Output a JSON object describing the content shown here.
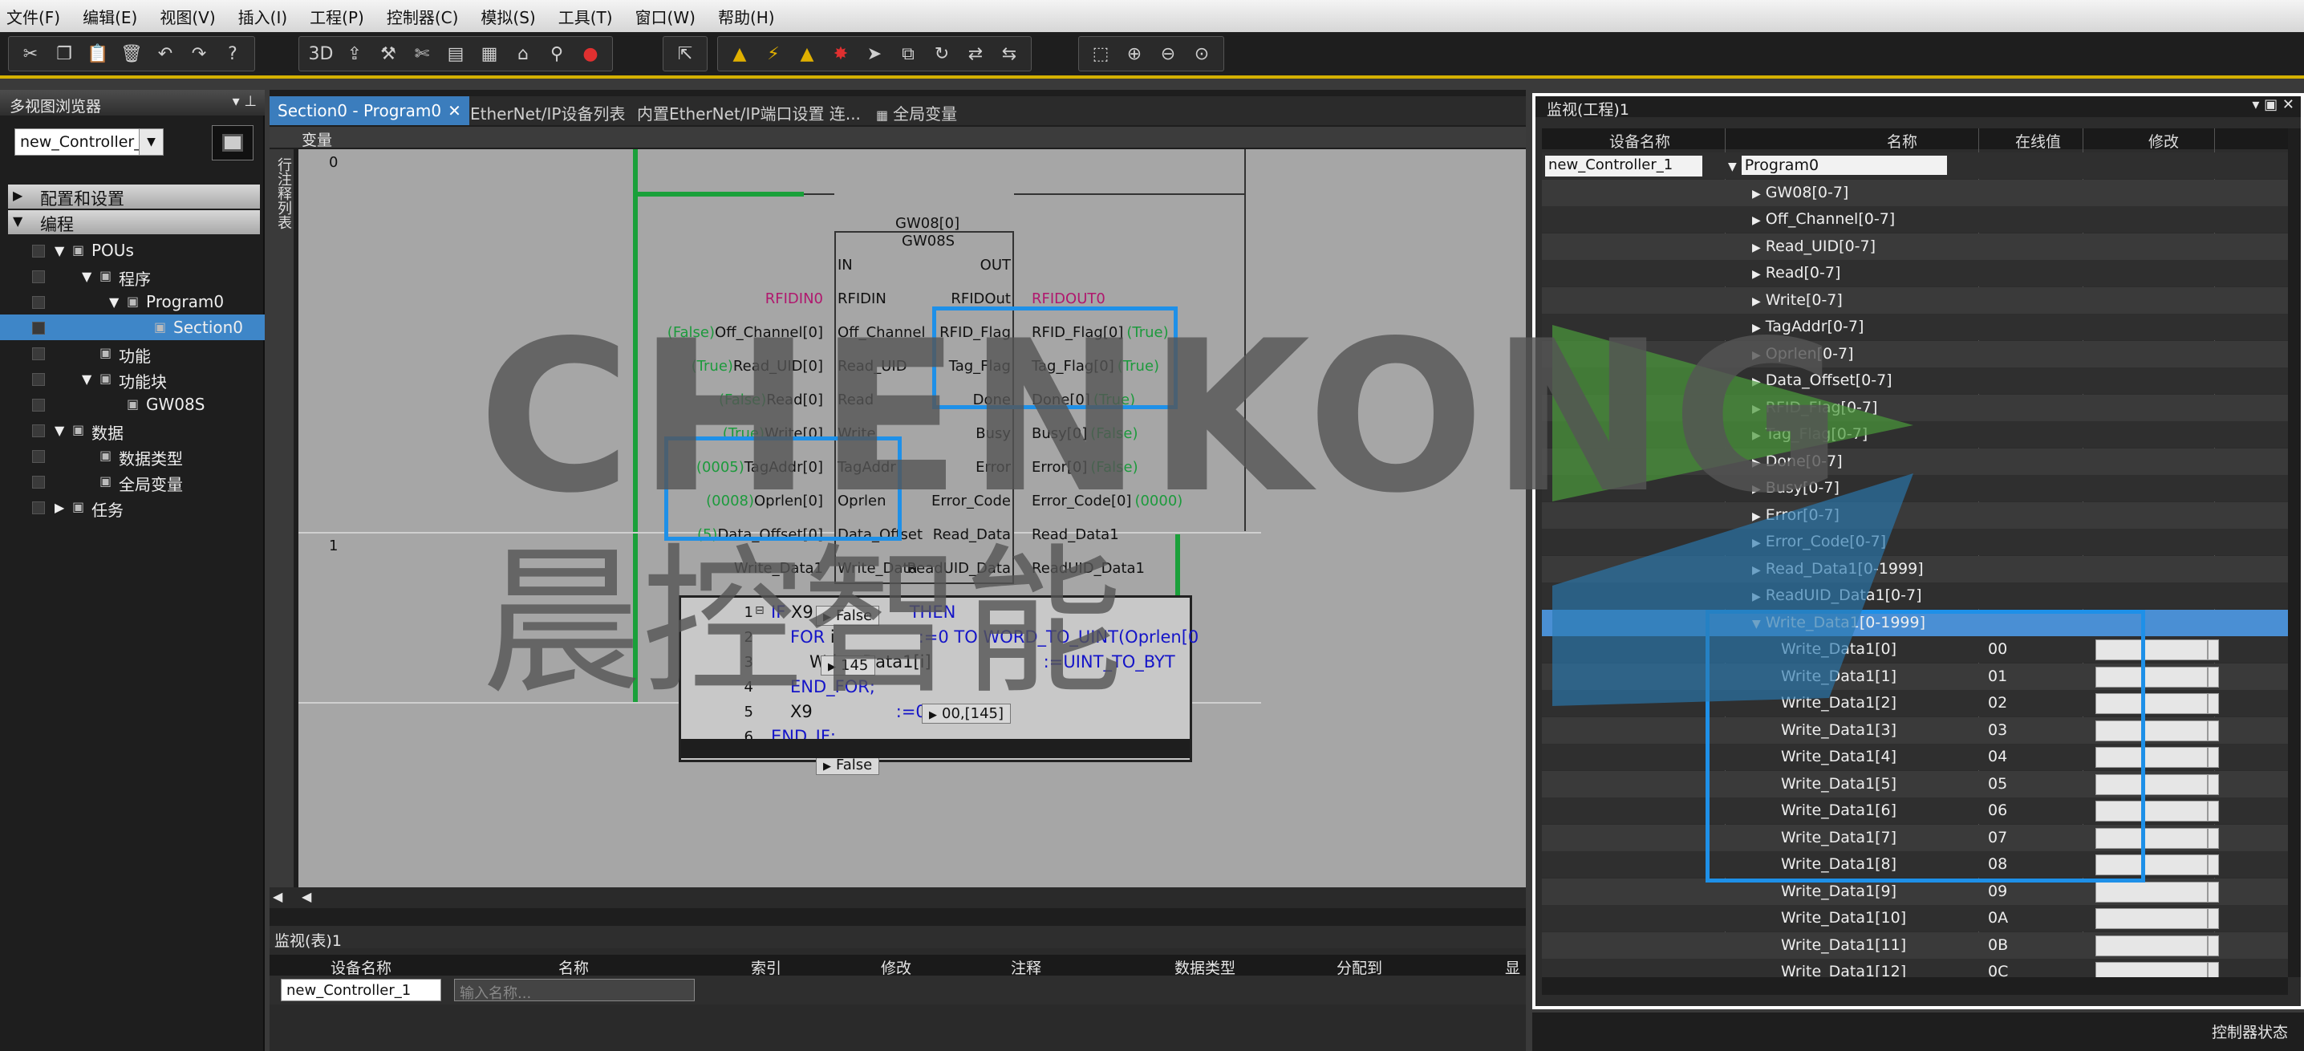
{
  "menu": [
    "文件(F)",
    "编辑(E)",
    "视图(V)",
    "插入(I)",
    "工程(P)",
    "控制器(C)",
    "模拟(S)",
    "工具(T)",
    "窗口(W)",
    "帮助(H)"
  ],
  "toolbar": {
    "groups": [
      [
        "cut-icon",
        "copy-icon",
        "paste-icon",
        "delete-icon",
        "undo-icon",
        "redo-icon",
        "help-icon"
      ],
      [
        "3d-icon",
        "export-icon",
        "build-icon",
        "tools-icon",
        "report-icon",
        "compare-icon",
        "cross-ref-icon",
        "find-icon",
        "breakpoint-icon"
      ],
      [
        "online-icon"
      ],
      [
        "warn1-icon",
        "warn2-icon",
        "warn3-icon",
        "alarm-icon",
        "arrow-icon",
        "copy-window-icon",
        "refresh-icon",
        "transfer-icon",
        "sync-icon"
      ],
      [
        "fit-icon",
        "zoom-in-icon",
        "zoom-out-icon",
        "zoom-reset-icon"
      ]
    ]
  },
  "left": {
    "title": "多视图浏览器",
    "controller": "new_Controller_1",
    "cat_config": "配置和设置",
    "cat_program": "编程",
    "tree": [
      {
        "label": "POUs",
        "indent": 1,
        "exp": "▼"
      },
      {
        "label": "程序",
        "indent": 2,
        "exp": "▼"
      },
      {
        "label": "Program0",
        "indent": 3,
        "exp": "▼"
      },
      {
        "label": "Section0",
        "indent": 4,
        "exp": "",
        "sel": true
      },
      {
        "label": "功能",
        "indent": 2,
        "exp": ""
      },
      {
        "label": "功能块",
        "indent": 2,
        "exp": "▼"
      },
      {
        "label": "GW08S",
        "indent": 3,
        "exp": ""
      },
      {
        "label": "数据",
        "indent": 1,
        "exp": "▼"
      },
      {
        "label": "数据类型",
        "indent": 2,
        "exp": ""
      },
      {
        "label": "全局变量",
        "indent": 2,
        "exp": ""
      },
      {
        "label": "任务",
        "indent": 1,
        "exp": "▶"
      }
    ]
  },
  "editor": {
    "tabs": [
      "Section0 - Program0",
      "EtherNet/IP设备列表",
      "内置EtherNet/IP端口设置 连...",
      "全局变量"
    ],
    "var_label": "变量",
    "side_label": "行注释列表",
    "rung0": "0",
    "rung1": "1",
    "fb_instance": "GW08[0]",
    "fb_type": "GW08S",
    "inputs": [
      {
        "pin": "IN",
        "var": "",
        "val": ""
      },
      {
        "pin": "RFIDIN",
        "var": "RFIDIN0",
        "val": ""
      },
      {
        "pin": "Off_Channel",
        "var": "Off_Channel[0]",
        "val": "(False)"
      },
      {
        "pin": "Read_UID",
        "var": "Read_UID[0]",
        "val": "(True)"
      },
      {
        "pin": "Read",
        "var": "Read[0]",
        "val": "(False)"
      },
      {
        "pin": "Write",
        "var": "Write[0]",
        "val": "(True)"
      },
      {
        "pin": "TagAddr",
        "var": "TagAddr[0]",
        "val": "(0005)"
      },
      {
        "pin": "Oprlen",
        "var": "Oprlen[0]",
        "val": "(0008)"
      },
      {
        "pin": "Data_Offset",
        "var": "Data_Offset[0]",
        "val": "(5)"
      },
      {
        "pin": "Write_Data",
        "var": "Write_Data1",
        "val": ""
      }
    ],
    "outputs": [
      {
        "pin": "OUT",
        "var": "",
        "val": ""
      },
      {
        "pin": "RFIDOut",
        "var": "RFIDOUT0",
        "val": ""
      },
      {
        "pin": "RFID_Flag",
        "var": "RFID_Flag[0]",
        "val": "(True)"
      },
      {
        "pin": "Tag_Flag",
        "var": "Tag_Flag[0]",
        "val": "(True)"
      },
      {
        "pin": "Done",
        "var": "Done[0]",
        "val": "(True)"
      },
      {
        "pin": "Busy",
        "var": "Busy[0]",
        "val": "(False)"
      },
      {
        "pin": "Error",
        "var": "Error[0]",
        "val": "(False)"
      },
      {
        "pin": "Error_Code",
        "var": "Error_Code[0]",
        "val": "(0000)"
      },
      {
        "pin": "Read_Data",
        "var": "Read_Data1",
        "val": ""
      },
      {
        "pin": "ReadUID_Data",
        "var": "ReadUID_Data1",
        "val": ""
      }
    ],
    "code": [
      {
        "n": "1",
        "t1": "IF X9",
        "t2": "",
        "t3": "THEN"
      },
      {
        "n": "2",
        "t1": "FOR i",
        "t2": ":=0 TO WORD_TO_UINT(Oprlen[0",
        "t3": ""
      },
      {
        "n": "3",
        "t1": "Write_Data1[i]",
        "t2": ":=UINT_TO_BYT",
        "t3": ""
      },
      {
        "n": "4",
        "t1": "END_FOR;",
        "t2": "",
        "t3": ""
      },
      {
        "n": "5",
        "t1": "X9",
        "t2": ":=0;",
        "t3": ""
      },
      {
        "n": "6",
        "t1": "END_IF;",
        "t2": "",
        "t3": ""
      }
    ],
    "tips": [
      "False",
      "145",
      "00,[145]",
      "False"
    ]
  },
  "bottom": {
    "title": "监视(表)1",
    "headers": [
      "设备名称",
      "名称",
      "索引",
      "修改",
      "注释",
      "数据类型",
      "分配到",
      "显"
    ],
    "device": "new_Controller_1",
    "name_placeholder": "输入名称..."
  },
  "right": {
    "title": "监视(工程)1",
    "headers": [
      "设备名称",
      "名称",
      "在线值",
      "修改"
    ],
    "device": "new_Controller_1",
    "rows": [
      {
        "name": "Program0",
        "indent": 0,
        "exp": "▼",
        "val": "",
        "mod": false
      },
      {
        "name": "GW08[0-7]",
        "indent": 1,
        "exp": "▶",
        "val": "",
        "mod": false
      },
      {
        "name": "Off_Channel[0-7]",
        "indent": 1,
        "exp": "▶",
        "val": "",
        "mod": false
      },
      {
        "name": "Read_UID[0-7]",
        "indent": 1,
        "exp": "▶",
        "val": "",
        "mod": false
      },
      {
        "name": "Read[0-7]",
        "indent": 1,
        "exp": "▶",
        "val": "",
        "mod": false
      },
      {
        "name": "Write[0-7]",
        "indent": 1,
        "exp": "▶",
        "val": "",
        "mod": false
      },
      {
        "name": "TagAddr[0-7]",
        "indent": 1,
        "exp": "▶",
        "val": "",
        "mod": false
      },
      {
        "name": "Oprlen[0-7]",
        "indent": 1,
        "exp": "▶",
        "val": "",
        "mod": false
      },
      {
        "name": "Data_Offset[0-7]",
        "indent": 1,
        "exp": "▶",
        "val": "",
        "mod": false
      },
      {
        "name": "RFID_Flag[0-7]",
        "indent": 1,
        "exp": "▶",
        "val": "",
        "mod": false
      },
      {
        "name": "Tag_Flag[0-7]",
        "indent": 1,
        "exp": "▶",
        "val": "",
        "mod": false
      },
      {
        "name": "Done[0-7]",
        "indent": 1,
        "exp": "▶",
        "val": "",
        "mod": false
      },
      {
        "name": "Busy[0-7]",
        "indent": 1,
        "exp": "▶",
        "val": "",
        "mod": false
      },
      {
        "name": "Error[0-7]",
        "indent": 1,
        "exp": "▶",
        "val": "",
        "mod": false
      },
      {
        "name": "Error_Code[0-7]",
        "indent": 1,
        "exp": "▶",
        "val": "",
        "mod": false
      },
      {
        "name": "Read_Data1[0-1999]",
        "indent": 1,
        "exp": "▶",
        "val": "",
        "mod": false
      },
      {
        "name": "ReadUID_Data1[0-7]",
        "indent": 1,
        "exp": "▶",
        "val": "",
        "mod": false
      },
      {
        "name": "Write_Data1[0-1999]",
        "indent": 1,
        "exp": "▼",
        "val": "",
        "mod": false,
        "sel": true
      },
      {
        "name": "Write_Data1[0]",
        "indent": 2,
        "exp": "",
        "val": "00",
        "mod": true
      },
      {
        "name": "Write_Data1[1]",
        "indent": 2,
        "exp": "",
        "val": "01",
        "mod": true
      },
      {
        "name": "Write_Data1[2]",
        "indent": 2,
        "exp": "",
        "val": "02",
        "mod": true
      },
      {
        "name": "Write_Data1[3]",
        "indent": 2,
        "exp": "",
        "val": "03",
        "mod": true
      },
      {
        "name": "Write_Data1[4]",
        "indent": 2,
        "exp": "",
        "val": "04",
        "mod": true
      },
      {
        "name": "Write_Data1[5]",
        "indent": 2,
        "exp": "",
        "val": "05",
        "mod": true
      },
      {
        "name": "Write_Data1[6]",
        "indent": 2,
        "exp": "",
        "val": "06",
        "mod": true
      },
      {
        "name": "Write_Data1[7]",
        "indent": 2,
        "exp": "",
        "val": "07",
        "mod": true
      },
      {
        "name": "Write_Data1[8]",
        "indent": 2,
        "exp": "",
        "val": "08",
        "mod": true
      },
      {
        "name": "Write_Data1[9]",
        "indent": 2,
        "exp": "",
        "val": "09",
        "mod": true
      },
      {
        "name": "Write_Data1[10]",
        "indent": 2,
        "exp": "",
        "val": "0A",
        "mod": true
      },
      {
        "name": "Write_Data1[11]",
        "indent": 2,
        "exp": "",
        "val": "0B",
        "mod": true
      },
      {
        "name": "Write_Data1[12]",
        "indent": 2,
        "exp": "",
        "val": "0C",
        "mod": true
      }
    ],
    "status": "控制器状态"
  },
  "watermark": {
    "text_en": "CHENKONG",
    "text_cn": "晨控智能",
    "color": "#555555"
  },
  "colors": {
    "accent": "#3b7dbd",
    "highlight": "#1e90e8",
    "toolbar_bottom": "#d4b000"
  }
}
